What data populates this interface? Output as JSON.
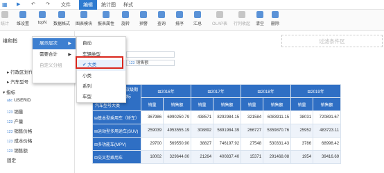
{
  "topbar": {
    "items": [
      "文件",
      "编辑",
      "统计图",
      "样式"
    ],
    "active": "编辑"
  },
  "ribbon": {
    "buttons": [
      "统计",
      "维设置",
      "topN",
      "数据格式",
      "图表模块",
      "报表属性",
      "旋转",
      "预警",
      "查询",
      "排序",
      "汇总",
      "OLAP表",
      "行列收起",
      "清空",
      "删除"
    ]
  },
  "left": {
    "title": "维和指",
    "tree": [
      {
        "label": "行政区划代码",
        "tag": ""
      },
      {
        "label": "汽车型号",
        "tag": ""
      },
      {
        "label": "指标",
        "tag": ""
      },
      {
        "label": "USERID",
        "tag": "abc"
      },
      {
        "label": "销量",
        "tag": "123"
      },
      {
        "label": "产量",
        "tag": "123"
      },
      {
        "label": "销售价格",
        "tag": "123"
      },
      {
        "label": "成本价格",
        "tag": "123"
      },
      {
        "label": "销售额",
        "tag": "123"
      },
      {
        "label": "固定",
        "tag": ""
      }
    ]
  },
  "menu1": {
    "items": [
      "展示层次",
      "需要合计",
      "自定义分组"
    ]
  },
  "menu2": {
    "items": [
      "自动",
      "车辆类型",
      "大类",
      "小类",
      "系列",
      "车型"
    ],
    "selected": "大类"
  },
  "fields": {
    "measure": "销售额",
    "tag": "123"
  },
  "filter_area": "过滤条件区",
  "table": {
    "corner1": "汉级期",
    "corner2": "指标",
    "corner3": "汽车型号大类",
    "years": [
      "2016年",
      "2017年",
      "2018年",
      "2019年"
    ],
    "subheaders": [
      "销量",
      "销售额"
    ],
    "rows": [
      {
        "name": "基本型乘用车（轿车）",
        "values": [
          "367986",
          "6990250.79",
          "438571",
          "8292984.15",
          "321584",
          "6083911.15",
          "38031",
          "720891.67"
        ]
      },
      {
        "name": "运动型多用途车(SUV)",
        "values": [
          "259039",
          "4953555.19",
          "308892",
          "5891984.39",
          "266727",
          "5359870.76",
          "25952",
          "483723.11"
        ]
      },
      {
        "name": "多功能车(MPV)",
        "values": [
          "29700",
          "569550.90",
          "38827",
          "746197.92",
          "27548",
          "530331.43",
          "3786",
          "68998.42"
        ]
      },
      {
        "name": "交叉型乘用车",
        "values": [
          "18002",
          "329644.00",
          "21264",
          "400837.40",
          "15371",
          "291468.08",
          "1954",
          "39416.69"
        ]
      }
    ]
  }
}
